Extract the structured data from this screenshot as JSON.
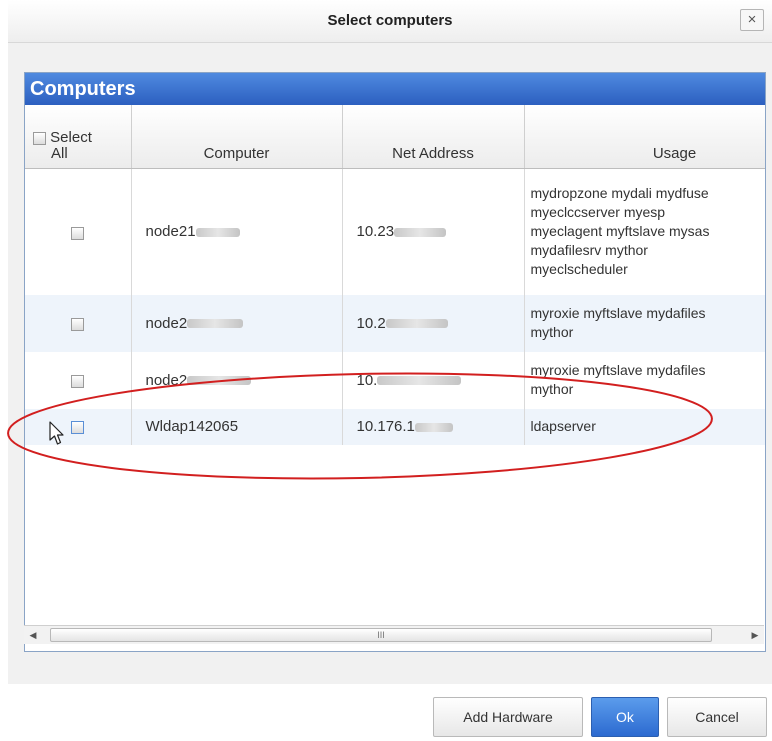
{
  "dialog": {
    "title": "Select computers",
    "close_glyph": "×"
  },
  "panel": {
    "title": "Computers"
  },
  "table": {
    "select_all_label_line1": "Select",
    "select_all_label_line2": "All",
    "columns": [
      "Computer",
      "Net Address",
      "Usage"
    ],
    "rows": [
      {
        "computer": "node21",
        "computer_obscured": true,
        "address": "10.23",
        "address_obscured": true,
        "usage": [
          "mydropzone mydali mydfuse",
          "myeclccserver myesp",
          "myeclagent myftslave mysas",
          "mydafilesrv mythor",
          "myeclscheduler"
        ]
      },
      {
        "computer": "node2",
        "computer_obscured": true,
        "address": "10.2",
        "address_obscured": true,
        "usage": [
          "myroxie myftslave mydafiles",
          "mythor"
        ]
      },
      {
        "computer": "node2",
        "computer_obscured": true,
        "address": "10.",
        "address_obscured": true,
        "usage": [
          "myroxie myftslave mydafiles",
          "mythor"
        ]
      },
      {
        "computer": "Wldap142065",
        "computer_obscured": false,
        "address": "10.176.1",
        "address_obscured": true,
        "usage": [
          "ldapserver"
        ]
      }
    ]
  },
  "scrollbar": {
    "grip_glyph": "III",
    "left_glyph": "◀",
    "right_glyph": "▶"
  },
  "buttons": {
    "add_hardware": "Add Hardware",
    "ok": "Ok",
    "cancel": "Cancel"
  },
  "annotation": {
    "color": "#d21f1f"
  },
  "icons": {
    "cursor": "mouse-pointer-icon",
    "close": "close-icon"
  }
}
